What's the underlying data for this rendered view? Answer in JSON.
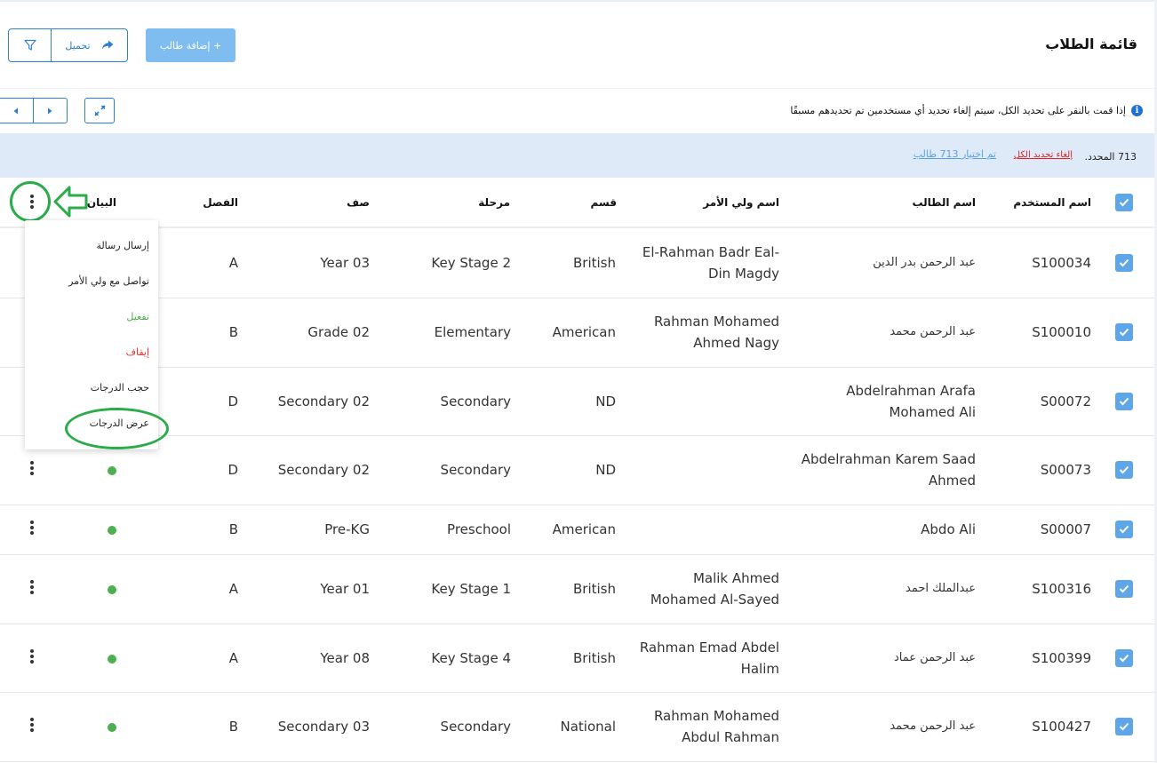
{
  "page_title": "قائمة الطلاب",
  "toolbar": {
    "add_student": "+ إضافة طالب",
    "load": "تحميل"
  },
  "info_text": "إذا قمت بالنقر على تحديد الكل، سيتم إلغاء تحديد أي مستخدمين تم تحديدهم مسبقًا",
  "selection": {
    "count_text": "713 المحدد.",
    "unselect_all": "إلغاء تحديد الكل",
    "selected_link": "تم اختيار 713 طالب"
  },
  "columns": {
    "username": "اسم المستخدم",
    "student_name": "اسم الطالب",
    "guardian_name": "اسم ولي الأمر",
    "department": "قسم",
    "stage": "مرحلة",
    "grade": "صف",
    "class": "الفصل",
    "info": "البيان"
  },
  "rows": [
    {
      "username": "S100034",
      "student": "عبد الرحمن بدر الدين",
      "guardian": [
        "El-Rahman Badr Eal-",
        "Din Magdy"
      ],
      "department": "British",
      "stage": "Key Stage 2",
      "grade": "Year 03",
      "class": "A"
    },
    {
      "username": "S100010",
      "student": "عبد الرحمن محمد",
      "guardian": [
        "Rahman Mohamed",
        "Ahmed Nagy"
      ],
      "department": "American",
      "stage": "Elementary",
      "grade": "Grade 02",
      "class": "B"
    },
    {
      "username": "S00072",
      "student": [
        "Abdelrahman Arafa",
        "Mohamed Ali"
      ],
      "guardian": [],
      "department": "ND",
      "stage": "Secondary",
      "grade": "Secondary 02",
      "class": "D"
    },
    {
      "username": "S00073",
      "student": [
        "Abdelrahman Karem Saad",
        "Ahmed"
      ],
      "guardian": [],
      "department": "ND",
      "stage": "Secondary",
      "grade": "Secondary 02",
      "class": "D"
    },
    {
      "username": "S00007",
      "student": "Abdo Ali",
      "guardian": [],
      "department": "American",
      "stage": "Preschool",
      "grade": "Pre-KG",
      "class": "B"
    },
    {
      "username": "S100316",
      "student": "عبدالملك احمد",
      "guardian": [
        "Malik Ahmed",
        "Mohamed Al-Sayed"
      ],
      "department": "British",
      "stage": "Key Stage 1",
      "grade": "Year 01",
      "class": "A"
    },
    {
      "username": "S100399",
      "student": "عبد الرحمن عماد",
      "guardian": [
        "Rahman Emad Abdel",
        "Halim"
      ],
      "department": "British",
      "stage": "Key Stage 4",
      "grade": "Year 08",
      "class": "A"
    },
    {
      "username": "S100427",
      "student": "عبد الرحمن محمد",
      "guardian": [
        "Rahman Mohamed",
        "Abdul Rahman"
      ],
      "department": "National",
      "stage": "Secondary",
      "grade": "Secondary 03",
      "class": "B"
    }
  ],
  "context_menu": {
    "send_message": "إرسال رسالة",
    "contact_guardian": "تواصل مع ولي الأمر",
    "activate": "تفعيل",
    "suspend": "إيقاف",
    "hide_grades": "حجب الدرجات",
    "show_grades": "عرض الدرجات"
  },
  "colors": {
    "primary": "#2d7fd0",
    "add_button": "#7fbcf0",
    "banner": "#dfeaf8",
    "checkbox": "#5ea6e8",
    "status_active": "#4caf50",
    "activate_text": "#4caf50",
    "suspend_text": "#e53935",
    "annotation": "#2bab4a"
  },
  "icons": [
    "filter-icon",
    "share-arrow-icon",
    "caret-left-icon",
    "caret-right-icon",
    "expand-icon",
    "info-icon",
    "check-icon",
    "kebab-icon",
    "arrow-left-annotation-icon"
  ]
}
